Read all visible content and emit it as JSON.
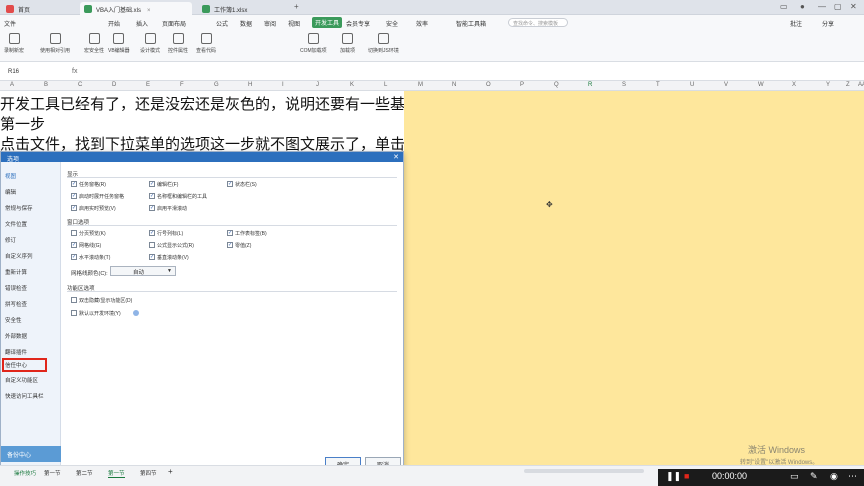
{
  "tabs": [
    {
      "label": "首页",
      "color": "#e24b4b"
    },
    {
      "label": "VBA入门基础.xls",
      "color": "#3b9a5b"
    },
    {
      "label": "工作簿1.xlsx",
      "color": "#3b9a5b"
    }
  ],
  "menu": {
    "file": "文件",
    "start": "开始",
    "insert": "插入",
    "layout": "页面布局",
    "formula": "公式",
    "data": "数据",
    "review": "审阅",
    "view": "视图",
    "dev": "开发工具",
    "member": "会员专享",
    "security": "安全",
    "efficiency": "效率",
    "smarttools": "智能工具箱",
    "search_placeholder": "查找命令、搜索模板",
    "share": "分享",
    "batch": "批注"
  },
  "toolbar": [
    "录制新宏",
    "使用相对引用",
    "宏安全性",
    "VB编辑器",
    "设计模式",
    "控件属性",
    "查看代码",
    "COM加载项",
    "加载项",
    "切换到JS环境"
  ],
  "formula_bar": {
    "cell": "R16",
    "fx": "fx"
  },
  "columns": [
    "A",
    "B",
    "C",
    "D",
    "E",
    "F",
    "G",
    "H",
    "I",
    "J",
    "K",
    "L",
    "M",
    "N",
    "O",
    "P",
    "Q",
    "R",
    "S",
    "T",
    "U",
    "V",
    "W",
    "X",
    "Y",
    "Z",
    "AA"
  ],
  "selected_column": "R",
  "sheet_lines": [
    "开发工具已经有了，还是没宏还是灰色的，说明还要有一些基础的操作的",
    "第一步",
    "点击文件，找到下拉菜单的选项这一步就不图文展示了，单击，我们已经学习过了，下一步点击信任中心"
  ],
  "dialog": {
    "title": "选项",
    "close": "✕",
    "nav": [
      "视图",
      "编辑",
      "常规与保存",
      "文件位置",
      "修订",
      "自定义序列",
      "重新计算",
      "错误检查",
      "拼写检查",
      "安全性",
      "外部数据",
      "翻译插件",
      "信任中心",
      "自定义功能区",
      "快速访问工具栏"
    ],
    "backup_label": "备份中心",
    "section_display": "显示",
    "display_options": [
      {
        "label": "任务窗格(R)",
        "checked": true
      },
      {
        "label": "编辑栏(F)",
        "checked": true
      },
      {
        "label": "状态栏(S)",
        "checked": true
      },
      {
        "label": "启动时展开任务窗格",
        "checked": true
      },
      {
        "label": "名称框和编辑栏的工具",
        "checked": true
      },
      {
        "label": "启用实时预览(V)",
        "checked": true
      },
      {
        "label": "启用平滑滚动",
        "checked": true
      }
    ],
    "section_window": "窗口选项",
    "window_options": [
      {
        "label": "分页预览(K)",
        "checked": false
      },
      {
        "label": "行号列标(L)",
        "checked": true
      },
      {
        "label": "工作表标签(B)",
        "checked": true
      },
      {
        "label": "网格线(G)",
        "checked": true
      },
      {
        "label": "公式显示公式(R)",
        "checked": false
      },
      {
        "label": "零值(Z)",
        "checked": true
      },
      {
        "label": "水平滚动条(T)",
        "checked": true
      },
      {
        "label": "垂直滚动条(V)",
        "checked": true
      }
    ],
    "gridline_color_label": "网格线颜色(C):",
    "gridline_color_value": "自动",
    "section_other": "功能区选项",
    "other_options": [
      {
        "label": "双击隐藏/显示功能区(D)",
        "checked": false
      },
      {
        "label": "默认以开发环境(Y)",
        "checked": false
      }
    ],
    "ok": "确定",
    "cancel": "取消"
  },
  "bottom": {
    "sheets": [
      "第一节",
      "第二节",
      "第一节",
      "第四节"
    ],
    "active_sheet": 2,
    "add": "+",
    "left_label": "操作技巧"
  },
  "recorder": {
    "time": "00:00:00"
  },
  "watermark": {
    "title": "激活 Windows",
    "sub": "转到\"设置\"以激活 Windows。"
  }
}
